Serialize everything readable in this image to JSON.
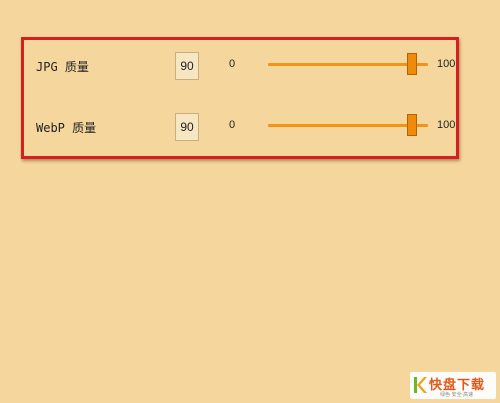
{
  "settings": {
    "rows": [
      {
        "label": "JPG 质量",
        "value": "90",
        "min_label": "0",
        "max_label": "100",
        "level": 90
      },
      {
        "label": "WebP 质量",
        "value": "90",
        "min_label": "0",
        "max_label": "100",
        "level": 90
      }
    ]
  },
  "watermark": {
    "logo_icon": "k-logo-icon",
    "text": "快盘下载",
    "subtext": "绿色·安全·高速"
  },
  "colors": {
    "background": "#f5d79e",
    "highlight_border": "#d42020",
    "slider_accent": "#f29414"
  }
}
